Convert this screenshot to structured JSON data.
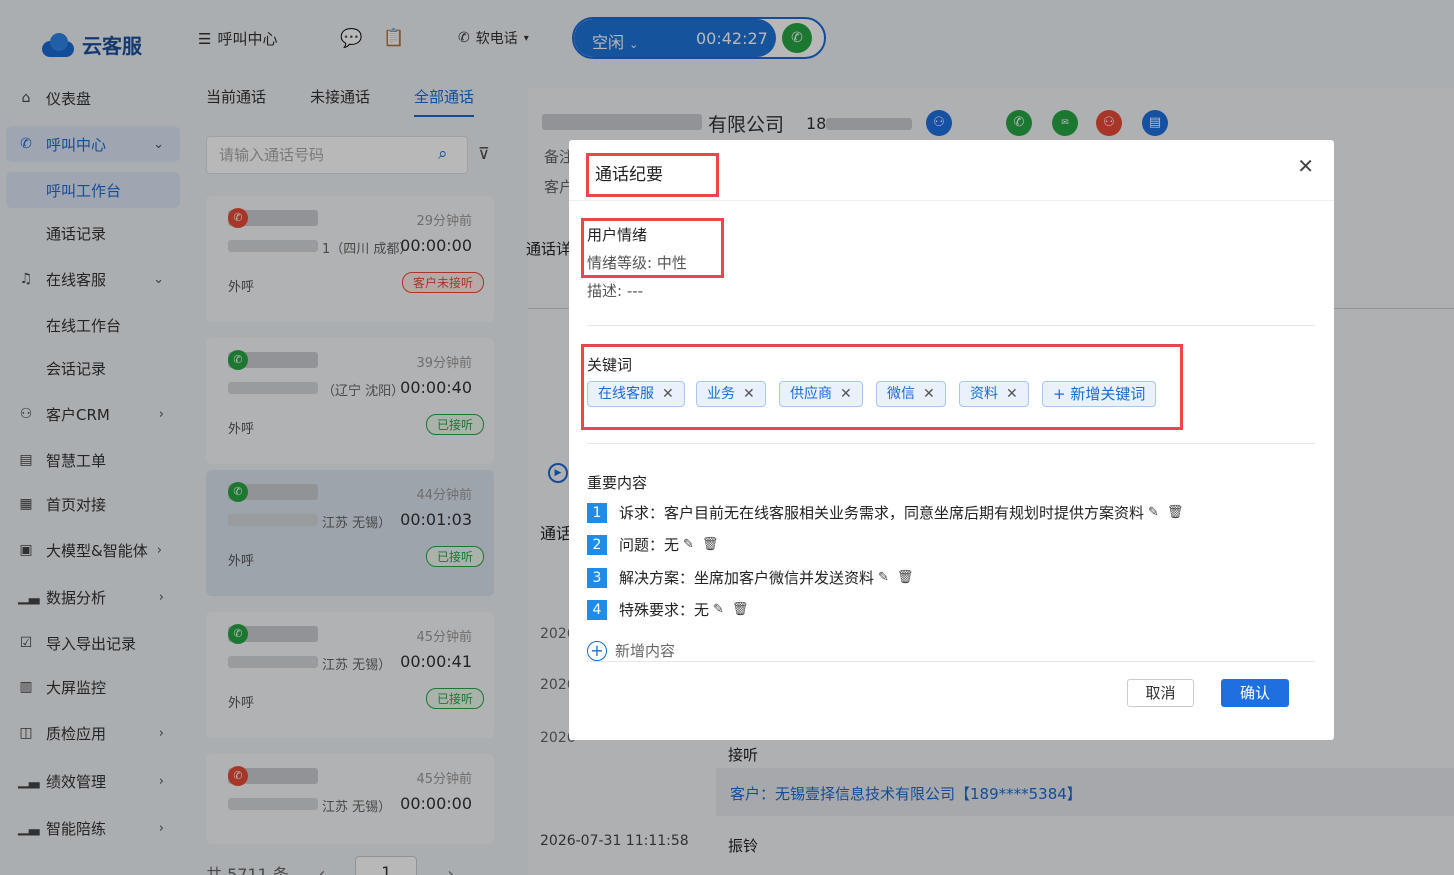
{
  "header": {
    "logo_text": "云客服",
    "call_center": "呼叫中心",
    "softphone": "软电话",
    "status": "空闲",
    "timer": "00:42:27"
  },
  "sidebar": {
    "items": [
      {
        "label": "仪表盘",
        "icon": "home-icon"
      },
      {
        "label": "呼叫中心",
        "icon": "phone-icon"
      },
      {
        "label": "呼叫工作台"
      },
      {
        "label": "通话记录"
      },
      {
        "label": "在线客服",
        "icon": "headset-icon"
      },
      {
        "label": "在线工作台"
      },
      {
        "label": "会话记录"
      },
      {
        "label": "客户CRM",
        "icon": "user-icon"
      },
      {
        "label": "智慧工单",
        "icon": "doc-icon"
      },
      {
        "label": "首页对接",
        "icon": "chart-icon"
      },
      {
        "label": "大模型&智能体",
        "icon": "ai-icon"
      },
      {
        "label": "数据分析",
        "icon": "bar-icon"
      },
      {
        "label": "导入导出记录",
        "icon": "check-icon"
      },
      {
        "label": "大屏监控",
        "icon": "screen-icon"
      },
      {
        "label": "质检应用",
        "icon": "qc-icon"
      },
      {
        "label": "绩效管理",
        "icon": "perf-icon"
      },
      {
        "label": "智能陪练",
        "icon": "train-icon"
      }
    ]
  },
  "list": {
    "tabs": [
      "当前通话",
      "未接通话",
      "全部通话"
    ],
    "search_placeholder": "请输入通话号码",
    "cards": [
      {
        "ago": "29分钟前",
        "loc": "1（四川 成都）",
        "dur": "00:00:00",
        "dir": "外呼",
        "badge": "客户未接听"
      },
      {
        "ago": "39分钟前",
        "loc": "（辽宁 沈阳）",
        "dur": "00:00:40",
        "dir": "外呼",
        "badge": "已接听"
      },
      {
        "ago": "44分钟前",
        "loc": "江苏 无锡）",
        "dur": "00:01:03",
        "dir": "外呼",
        "badge": "已接听"
      },
      {
        "ago": "45分钟前",
        "loc": "江苏 无锡）",
        "dur": "00:00:41",
        "dir": "外呼",
        "badge": "已接听"
      },
      {
        "ago": "45分钟前",
        "loc": "江苏 无锡）",
        "dur": "00:00:00",
        "dir": "",
        "badge": ""
      }
    ],
    "total": "共 5711 条",
    "page": "1"
  },
  "detail": {
    "company": "有限公司",
    "phone_prefix": "18",
    "remark_label": "备注",
    "customer_label": "客户",
    "call_detail_label": "通话详",
    "call_label": "通话",
    "years": [
      "2026",
      "2026",
      "2026"
    ],
    "log_text_1": "接听",
    "customer_line": "客户：无锡壹择信息技术有限公司【189****5384】",
    "last_time": "2026-07-31 11:11:58",
    "last_event": "振铃"
  },
  "modal": {
    "title": "通话纪要",
    "emotion_title": "用户情绪",
    "emotion_level": "情绪等级: 中性",
    "description": "描述: ---",
    "keywords_title": "关键词",
    "keywords": [
      "在线客服",
      "业务",
      "供应商",
      "微信",
      "资料"
    ],
    "add_keyword": "+ 新增关键词",
    "important_title": "重要内容",
    "items": [
      {
        "n": "1",
        "text": "诉求：客户目前无在线客服相关业务需求，同意坐席后期有规划时提供方案资料"
      },
      {
        "n": "2",
        "text": "问题：无"
      },
      {
        "n": "3",
        "text": "解决方案：坐席加客户微信并发送资料"
      },
      {
        "n": "4",
        "text": "特殊要求：无"
      }
    ],
    "add_content": "新增内容",
    "cancel": "取消",
    "confirm": "确认"
  }
}
